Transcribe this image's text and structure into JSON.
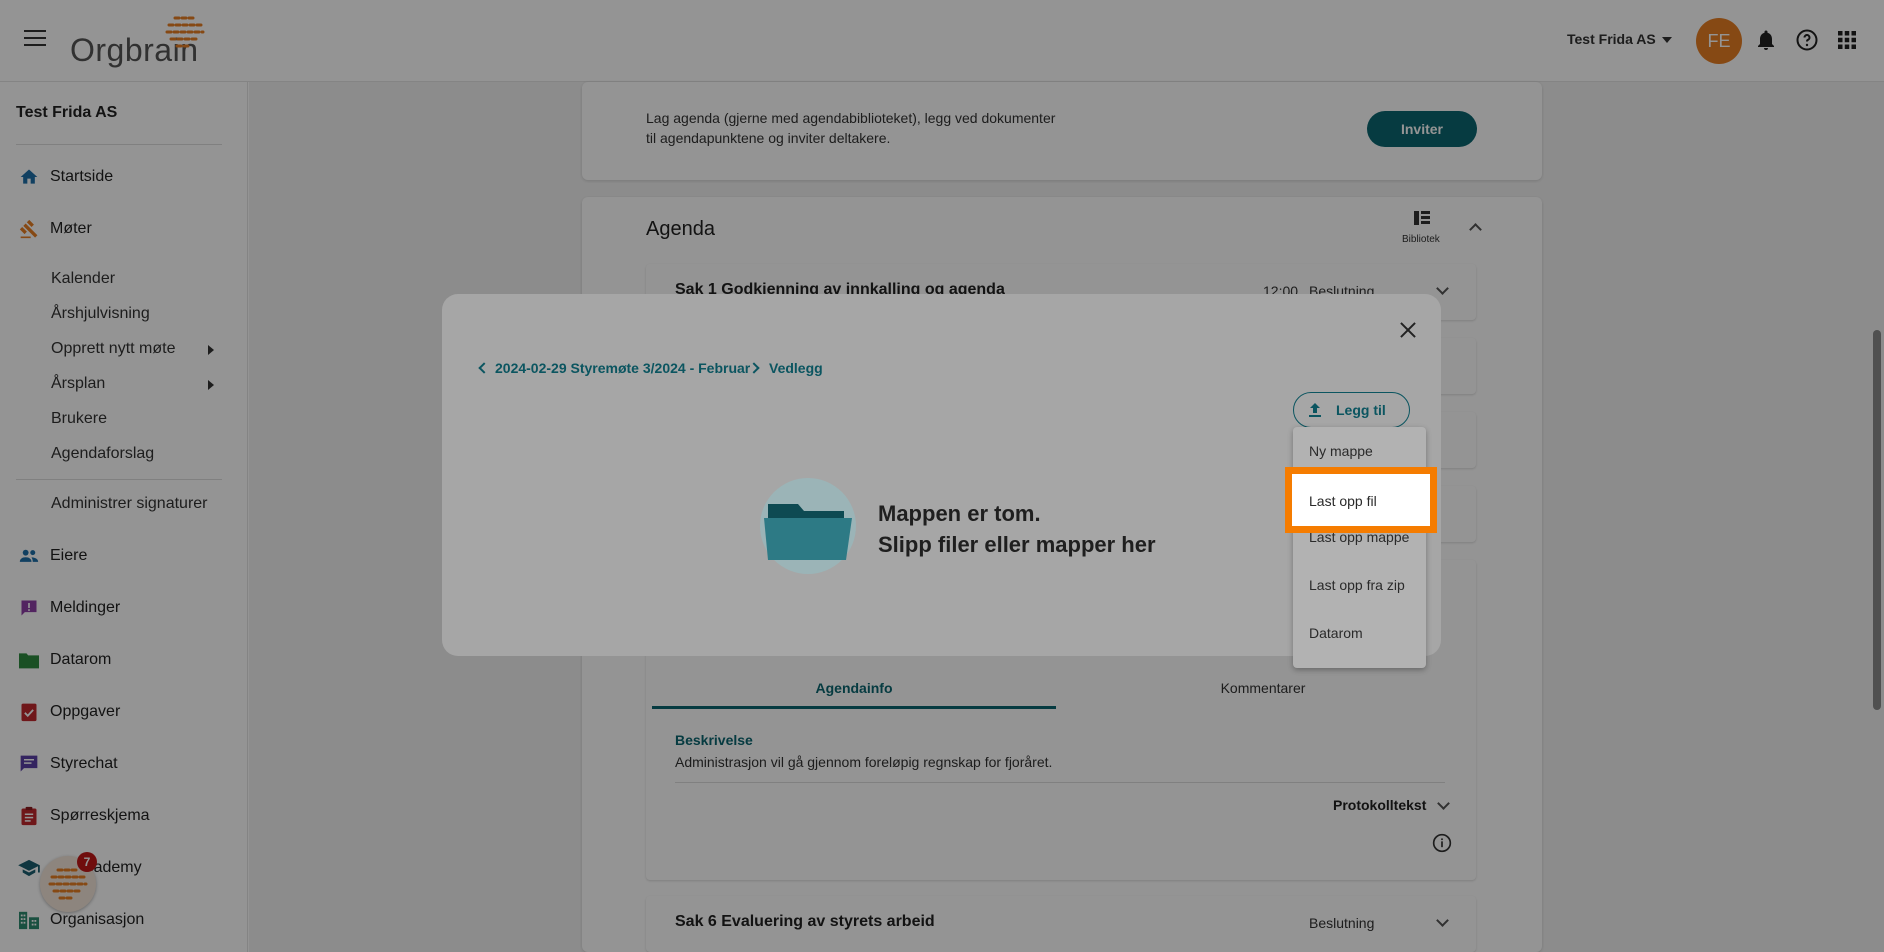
{
  "app": {
    "logo_text": "Orgbrain",
    "company": "Test Frida AS",
    "avatar_initials": "FE"
  },
  "sidebar": {
    "company": "Test Frida AS",
    "items": [
      {
        "label": "Startside",
        "icon": "home-icon"
      },
      {
        "label": "Møter",
        "icon": "gavel-icon"
      },
      {
        "label": "Eiere",
        "icon": "people-icon"
      },
      {
        "label": "Meldinger",
        "icon": "message-alert-icon"
      },
      {
        "label": "Datarom",
        "icon": "folder-icon"
      },
      {
        "label": "Oppgaver",
        "icon": "task-icon"
      },
      {
        "label": "Styrechat",
        "icon": "chat-icon"
      },
      {
        "label": "Spørreskjema",
        "icon": "clipboard-icon"
      },
      {
        "label": "ain Academy",
        "icon": "school-icon"
      },
      {
        "label": "Organisasjon",
        "icon": "organization-icon"
      }
    ],
    "moter_sub": [
      "Kalender",
      "Årshjulvisning",
      "Opprett nytt møte",
      "Årsplan",
      "Brukere",
      "Agendaforslag"
    ],
    "admin_signatures": "Administrer signaturer",
    "fab_badge": "7"
  },
  "main": {
    "invite_text_1": "Lag agenda (gjerne med agendabiblioteket), legg ved dokumenter",
    "invite_text_2": "til agendapunktene og inviter deltakere.",
    "invite_button": "Inviter",
    "agenda_title": "Agenda",
    "library_label": "Bibliotek",
    "sak1_title": "Sak 1 Godkjenning av innkalling og agenda",
    "sak1_time": "12:00",
    "sak1_type": "Beslutning",
    "tab_agendainfo": "Agendainfo",
    "tab_kommentarer": "Kommentarer",
    "beskrivelse_label": "Beskrivelse",
    "beskrivelse_text": "Administrasjon vil gå gjennom foreløpig regnskap for fjoråret.",
    "protokolltekst": "Protokolltekst",
    "sak6_title": "Sak 6 Evaluering av styrets arbeid",
    "sak6_type": "Beslutning"
  },
  "modal": {
    "breadcrumb_meeting": "2024-02-29 Styremøte 3/2024 - Februar",
    "breadcrumb_folder": "Vedlegg",
    "add_button": "Legg til",
    "empty_line1": "Mappen er tom.",
    "empty_line2": "Slipp filer eller mapper her",
    "menu": [
      "Ny mappe",
      "Last opp fil",
      "Last opp mappe",
      "Last opp fra zip",
      "Datarom"
    ]
  },
  "colors": {
    "accent": "#0b6670",
    "highlight": "#f57c00",
    "avatar": "#e77f24"
  }
}
